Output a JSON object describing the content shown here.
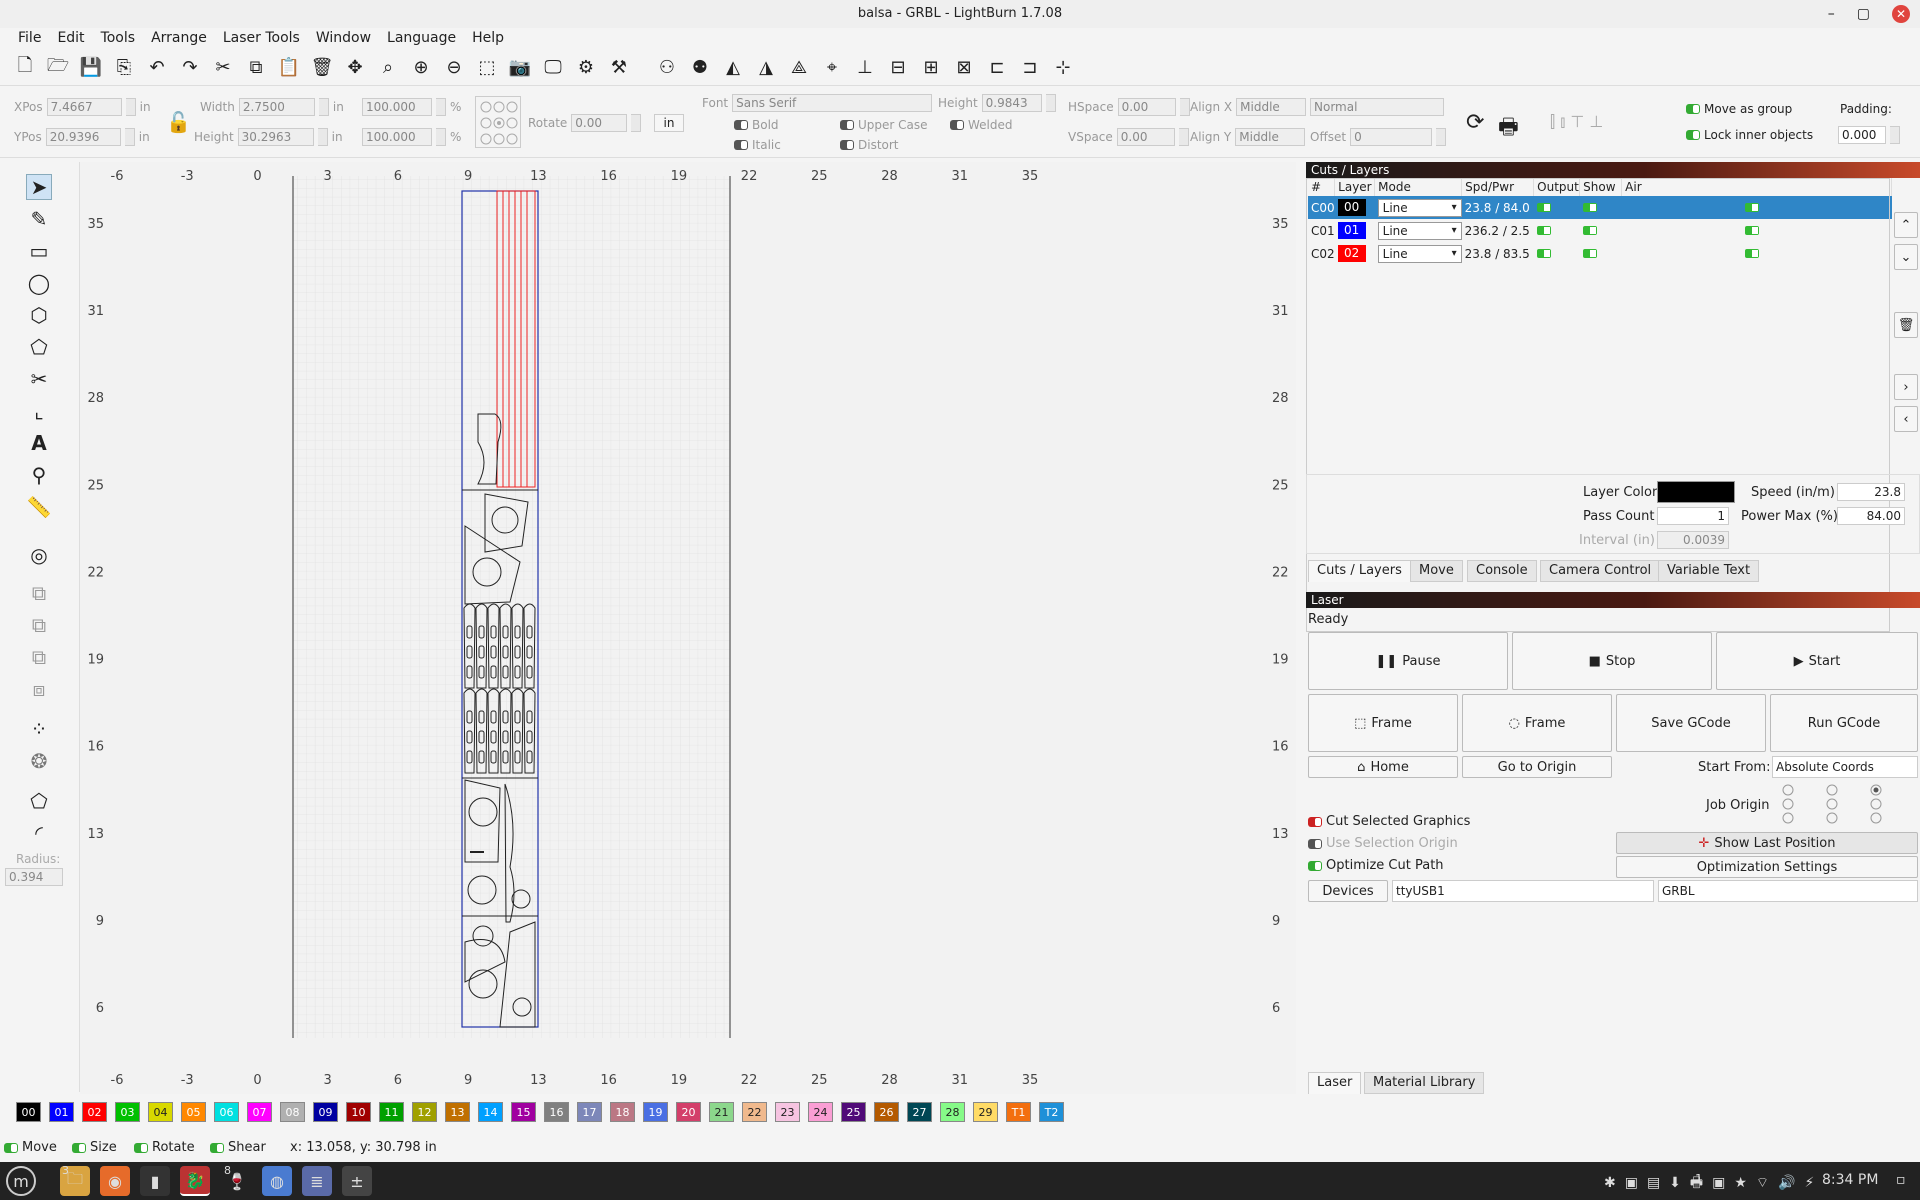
{
  "window": {
    "title": "balsa - GRBL - LightBurn 1.7.08",
    "min": "–",
    "max": "▢",
    "close": "✕"
  },
  "menu": [
    "File",
    "Edit",
    "Tools",
    "Arrange",
    "Laser Tools",
    "Window",
    "Language",
    "Help"
  ],
  "toolbar_icons": [
    "new-file",
    "open",
    "save",
    "import",
    "undo",
    "redo",
    "cut",
    "copy",
    "paste",
    "delete",
    "move",
    "zoom-frame",
    "zoom-in",
    "zoom-out",
    "zoom-select",
    "camera",
    "monitor",
    "settings",
    "tools",
    "group",
    "ungroup",
    "mirror-h",
    "mirror-v",
    "mirror-any",
    "center",
    "align-top",
    "align-middle",
    "distribute-h",
    "distribute-v",
    "align-left",
    "align-center",
    "origin"
  ],
  "props": {
    "xpos_label": "XPos",
    "xpos": "7.4667",
    "ypos_label": "YPos",
    "ypos": "20.9396",
    "width_label": "Width",
    "width": "2.7500",
    "height_label": "Height",
    "height": "30.2963",
    "unit_in": "in",
    "pct1": "100.000",
    "pct2": "100.000",
    "pct": "%",
    "rotate_label": "Rotate",
    "rotate": "0.00",
    "unit_btn": "in",
    "font_label": "Font",
    "font": "Sans Serif",
    "fheight_label": "Height",
    "fheight": "0.9843",
    "bold": "Bold",
    "italic": "Italic",
    "upper": "Upper Case",
    "distort": "Distort",
    "welded": "Welded",
    "hspace_label": "HSpace",
    "hspace": "0.00",
    "vspace_label": "VSpace",
    "vspace": "0.00",
    "alignx_label": "Align X",
    "alignx": "Middle",
    "aligny_label": "Align Y",
    "aligny": "Middle",
    "normal": "Normal",
    "offset_label": "Offset",
    "offset": "0",
    "move_group": "Move as group",
    "lock_inner": "Lock inner objects",
    "padding_label": "Padding:",
    "padding": "0.000"
  },
  "left_tools": {
    "radius_label": "Radius:",
    "radius": "0.394"
  },
  "ruler": {
    "x": [
      "-6",
      "-3",
      "0",
      "3",
      "6",
      "9",
      "13",
      "16",
      "19",
      "22",
      "25",
      "28",
      "31",
      "35"
    ],
    "y": [
      "35",
      "31",
      "28",
      "25",
      "22",
      "19",
      "16",
      "13",
      "9",
      "6"
    ]
  },
  "cuts": {
    "title": "Cuts / Layers",
    "headers": [
      "#",
      "Layer",
      "Mode",
      "Spd/Pwr",
      "Output",
      "Show",
      "Air"
    ],
    "rows": [
      {
        "id": "C00",
        "layer": "00",
        "color": "#000000",
        "mode": "Line",
        "spdpwr": "23.8 / 84.0",
        "selected": true
      },
      {
        "id": "C01",
        "layer": "01",
        "color": "#0000ff",
        "mode": "Line",
        "spdpwr": "236.2 / 2.5",
        "selected": false
      },
      {
        "id": "C02",
        "layer": "02",
        "color": "#ff0000",
        "mode": "Line",
        "spdpwr": "23.8 / 83.5",
        "selected": false
      }
    ],
    "layer_color_label": "Layer Color",
    "speed_label": "Speed (in/m)",
    "speed": "23.8",
    "pass_label": "Pass Count",
    "pass": "1",
    "power_label": "Power Max (%)",
    "power": "84.00",
    "interval_label": "Interval (in)",
    "interval": "0.0039"
  },
  "tabs1": [
    "Cuts / Layers",
    "Move",
    "Console",
    "Camera Control",
    "Variable Text"
  ],
  "laser": {
    "title": "Laser",
    "status": "Ready",
    "pause": "Pause",
    "stop": "Stop",
    "start": "Start",
    "frame1": "Frame",
    "frame2": "Frame",
    "save_gcode": "Save GCode",
    "run_gcode": "Run GCode",
    "home": "Home",
    "go_origin": "Go to Origin",
    "start_from_label": "Start From:",
    "start_from": "Absolute Coords",
    "job_origin": "Job Origin",
    "cut_selected": "Cut Selected Graphics",
    "use_sel_origin": "Use Selection Origin",
    "optimize": "Optimize Cut Path",
    "show_last": "Show Last Position",
    "opt_settings": "Optimization Settings",
    "devices": "Devices",
    "port": "ttyUSB1",
    "device": "GRBL"
  },
  "tabs2": [
    "Laser",
    "Material Library"
  ],
  "palette": [
    {
      "l": "00",
      "c": "#000000"
    },
    {
      "l": "01",
      "c": "#0000ff"
    },
    {
      "l": "02",
      "c": "#ff0000"
    },
    {
      "l": "03",
      "c": "#00c000"
    },
    {
      "l": "04",
      "c": "#d8d800"
    },
    {
      "l": "05",
      "c": "#ff8800"
    },
    {
      "l": "06",
      "c": "#00e0e0"
    },
    {
      "l": "07",
      "c": "#ff00ff"
    },
    {
      "l": "08",
      "c": "#b0b0b0"
    },
    {
      "l": "09",
      "c": "#0000a0"
    },
    {
      "l": "10",
      "c": "#a00000"
    },
    {
      "l": "11",
      "c": "#00a000"
    },
    {
      "l": "12",
      "c": "#a0a000"
    },
    {
      "l": "13",
      "c": "#c07000"
    },
    {
      "l": "14",
      "c": "#00a0ff"
    },
    {
      "l": "15",
      "c": "#a000a0"
    },
    {
      "l": "16",
      "c": "#808080"
    },
    {
      "l": "17",
      "c": "#7d87b9"
    },
    {
      "l": "18",
      "c": "#bb7784"
    },
    {
      "l": "19",
      "c": "#4a6fe3"
    },
    {
      "l": "20",
      "c": "#d33f6a"
    },
    {
      "l": "21",
      "c": "#8cd78c"
    },
    {
      "l": "22",
      "c": "#f0b98d"
    },
    {
      "l": "23",
      "c": "#f6c4e1"
    },
    {
      "l": "24",
      "c": "#fa9ed4"
    },
    {
      "l": "25",
      "c": "#500a78"
    },
    {
      "l": "26",
      "c": "#b45a00"
    },
    {
      "l": "27",
      "c": "#004754"
    },
    {
      "l": "28",
      "c": "#86fa88"
    },
    {
      "l": "29",
      "c": "#ffdb66"
    },
    {
      "l": "T1",
      "c": "#f36f0f"
    },
    {
      "l": "T2",
      "c": "#1e90d8"
    }
  ],
  "status": {
    "move": "Move",
    "size": "Size",
    "rotate": "Rotate",
    "shear": "Shear",
    "coords": "x: 13.058, y: 30.798 in"
  },
  "taskbar": {
    "time": "8:34 PM",
    "badge1": "3",
    "badge2": "8",
    "count": "1"
  }
}
